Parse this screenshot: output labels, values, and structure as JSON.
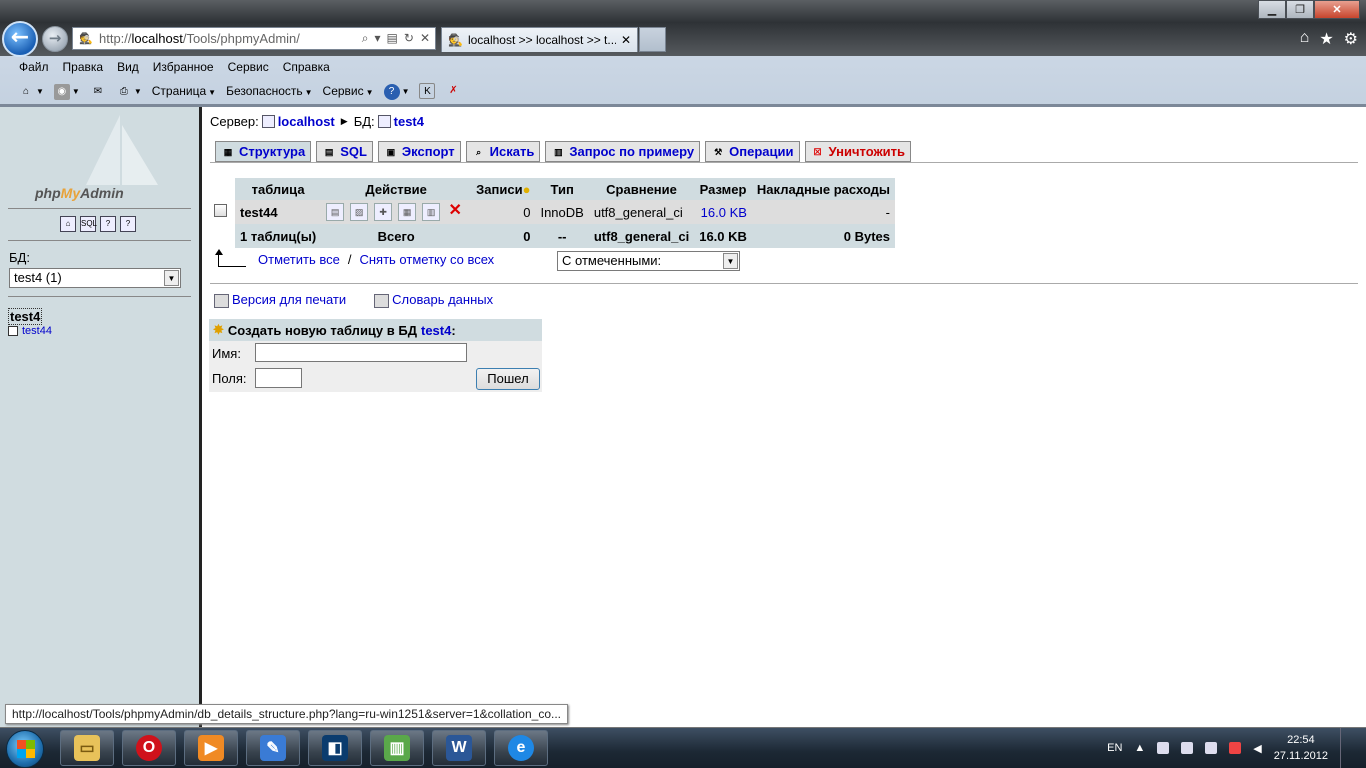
{
  "browser": {
    "address": {
      "prefix": "http://",
      "host": "localhost",
      "path": "/Tools/phpmyAdmin/"
    },
    "tab_title": "localhost >> localhost >> t...",
    "menu": [
      "Файл",
      "Правка",
      "Вид",
      "Избранное",
      "Сервис",
      "Справка"
    ],
    "toolbar": {
      "page": "Страница",
      "security": "Безопасность",
      "tools": "Сервис"
    }
  },
  "left": {
    "logo_php": "php",
    "logo_my": "My",
    "logo_admin": "Admin",
    "db_label": "БД:",
    "db_select": "test4 (1)",
    "db_name": "test4",
    "table_link": "test44"
  },
  "breadcrumb": {
    "server_label": "Сервер:",
    "server": "localhost",
    "db_label": "БД:",
    "db": "test4"
  },
  "tabs": [
    "Структура",
    "SQL",
    "Экспорт",
    "Искать",
    "Запрос по примеру",
    "Операции",
    "Уничтожить"
  ],
  "table": {
    "headers": [
      "таблица",
      "Действие",
      "Записи",
      "Тип",
      "Сравнение",
      "Размер",
      "Накладные расходы"
    ],
    "row": {
      "name": "test44",
      "records": "0",
      "type": "InnoDB",
      "collation": "utf8_general_ci",
      "size": "16.0 KB",
      "overhead": "-"
    },
    "total": {
      "name": "1 таблиц(ы)",
      "label": "Всего",
      "records": "0",
      "type": "--",
      "collation": "utf8_general_ci",
      "size": "16.0 KB",
      "overhead": "0 Bytes"
    }
  },
  "check_all": "Отметить все",
  "check_sep": "/",
  "uncheck_all": "Снять отметку со всех",
  "with_selected": "С отмеченными:",
  "print_version": "Версия для печати",
  "data_dictionary": "Словарь данных",
  "create": {
    "title": "Создать новую таблицу в БД",
    "db": "test4",
    "colon": ":",
    "name_label": "Имя:",
    "fields_label": "Поля:",
    "go": "Пошел"
  },
  "status_url": "http://localhost/Tools/phpmyAdmin/db_details_structure.php?lang=ru-win1251&server=1&collation_co...",
  "tray": {
    "lang": "EN",
    "time": "22:54",
    "date": "27.11.2012"
  }
}
